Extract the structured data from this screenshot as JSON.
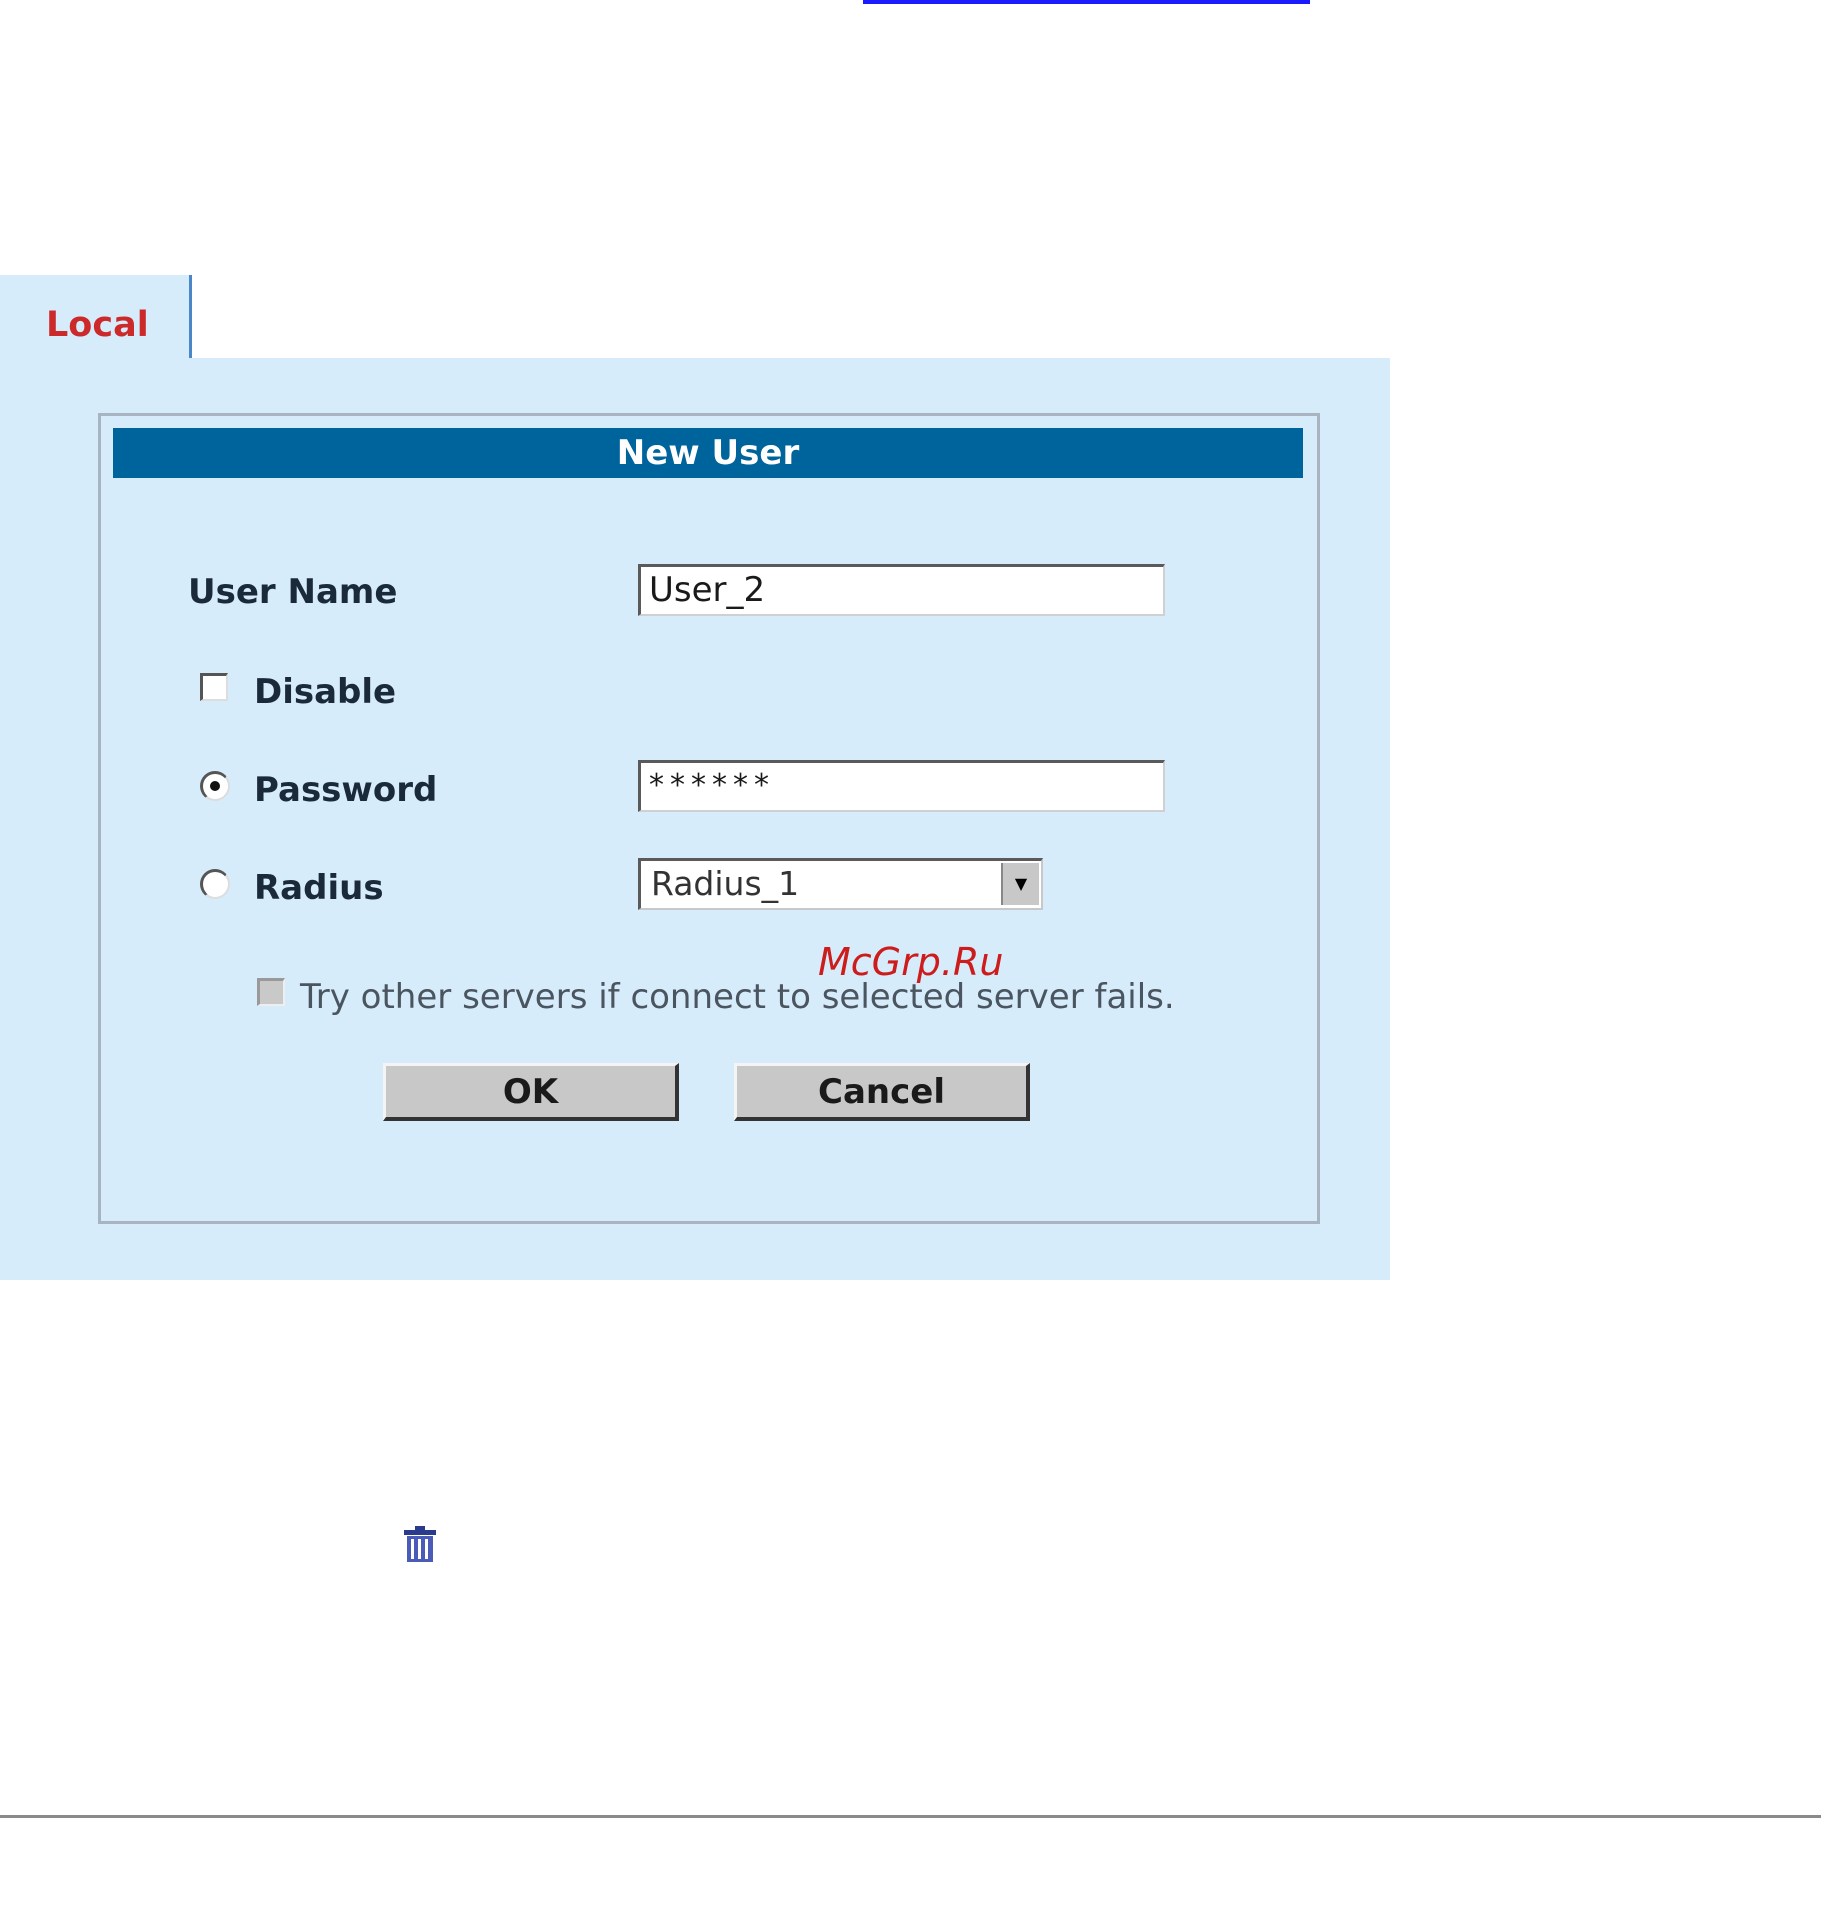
{
  "tab": {
    "label": "Local"
  },
  "dialog": {
    "title": "New User",
    "user_name": {
      "label": "User Name",
      "value": "User_2"
    },
    "disable": {
      "label": "Disable",
      "checked": false
    },
    "password": {
      "label": "Password",
      "value": "******",
      "selected": true
    },
    "radius": {
      "label": "Radius",
      "selected": false,
      "selected_value": "Radius_1"
    },
    "try_other": {
      "label": "Try other servers if connect to selected server fails.",
      "checked": false
    },
    "ok_label": "OK",
    "cancel_label": "Cancel"
  },
  "watermark": "McGrp.Ru",
  "icons": {
    "delete": "trash-icon"
  },
  "colors": {
    "title_bar": "#00649c",
    "panel": "#d6ecfa",
    "tab_text": "#cc2a2a",
    "link": "#1a1aff"
  }
}
